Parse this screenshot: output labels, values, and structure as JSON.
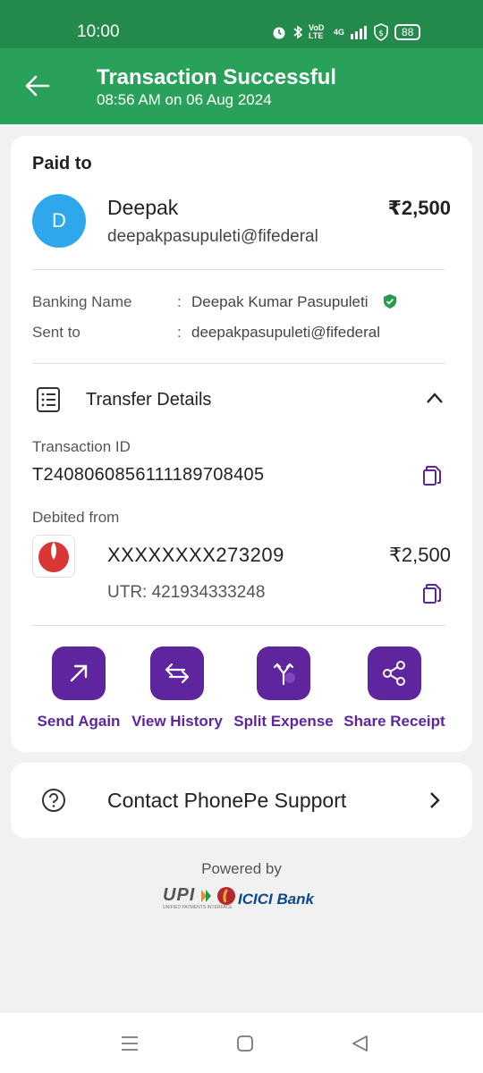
{
  "status_bar": {
    "time": "10:00",
    "carrier": "VoD LTE",
    "network": "4G",
    "battery": "88"
  },
  "header": {
    "title": "Transaction Successful",
    "subtitle": "08:56 AM on 06 Aug 2024",
    "bg_color": "#2aa15a"
  },
  "payment": {
    "section_label": "Paid to",
    "avatar_letter": "D",
    "payee_name": "Deepak",
    "payee_upi": "deepakpasupuleti@fifederal",
    "amount": "₹2,500"
  },
  "recipient": {
    "banking_name_key": "Banking Name",
    "banking_name_value": "Deepak Kumar Pasupuleti",
    "sent_to_key": "Sent to",
    "sent_to_value": "deepakpasupuleti@fifederal",
    "separator": ":"
  },
  "transfer_details": {
    "title": "Transfer Details",
    "transaction_id_label": "Transaction ID",
    "transaction_id": "T2408060856111189708405",
    "debited_from_label": "Debited from",
    "account_number": "XXXXXXXX273209",
    "debited_amount": "₹2,500",
    "utr": "UTR: 421934333248"
  },
  "actions": [
    {
      "label": "Send Again",
      "icon": "arrow-up-right-icon"
    },
    {
      "label": "View History",
      "icon": "swap-arrows-icon"
    },
    {
      "label": "Split Expense",
      "icon": "split-icon"
    },
    {
      "label": "Share Receipt",
      "icon": "share-icon"
    }
  ],
  "support": {
    "label": "Contact PhonePe Support"
  },
  "footer": {
    "powered_by": "Powered by",
    "upi": "UPI",
    "upi_tagline": "UNIFIED PAYMENTS INTERFACE",
    "bank": "ICICI Bank"
  },
  "colors": {
    "brand_purple": "#5f259f",
    "success_green": "#2aa15a",
    "avatar_blue": "#2ea7ed"
  }
}
